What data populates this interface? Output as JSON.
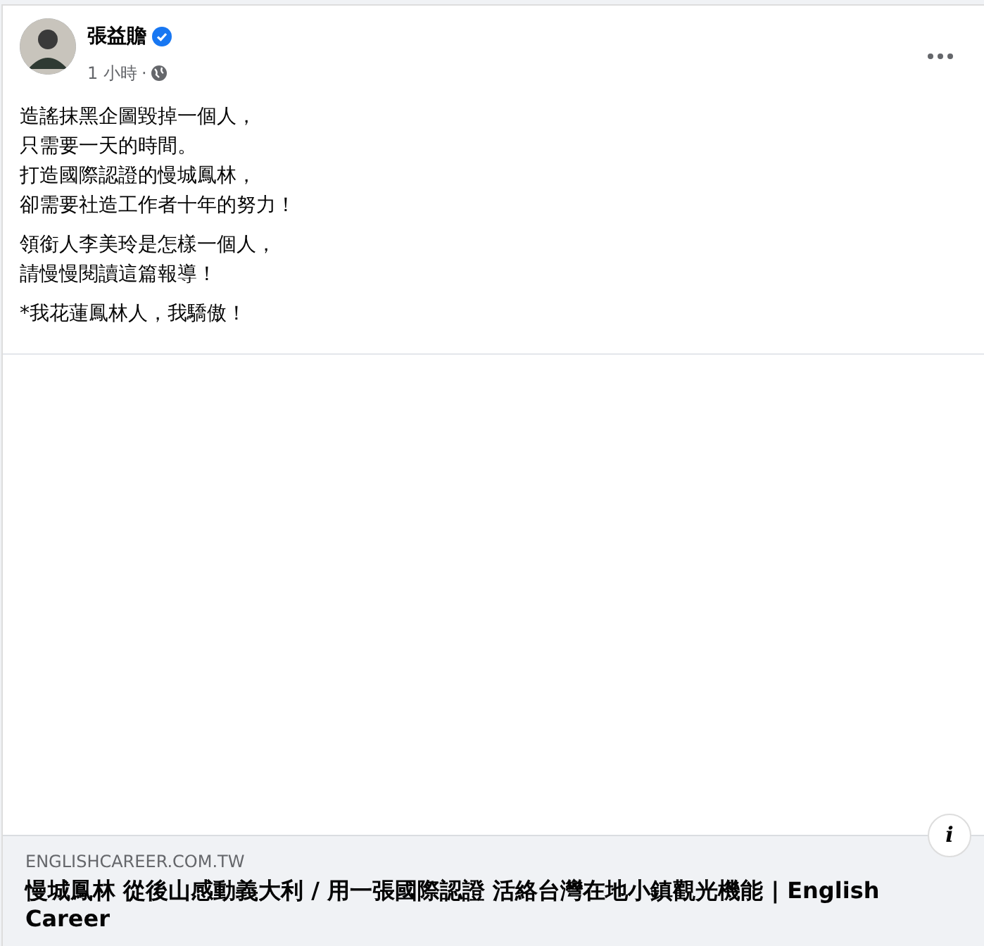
{
  "post": {
    "author": "張益贍",
    "verified": true,
    "time": "1 小時",
    "audience_separator": "·",
    "paragraphs": [
      [
        "造謠抹黑企圖毀掉一個人，",
        "只需要一天的時間。",
        "打造國際認證的慢城鳳林，",
        "卻需要社造工作者十年的努力！"
      ],
      [
        "領銜人李美玲是怎樣一個人，",
        "請慢慢閱讀這篇報導！"
      ],
      [
        "*我花蓮鳳林人，我驕傲！"
      ]
    ]
  },
  "link_preview": {
    "domain": "ENGLISHCAREER.COM.TW",
    "title": "慢城鳳林 從後山感動義大利 / 用一張國際認證 活絡台灣在地小鎮觀光機能 | English Career",
    "info_button": "i"
  }
}
